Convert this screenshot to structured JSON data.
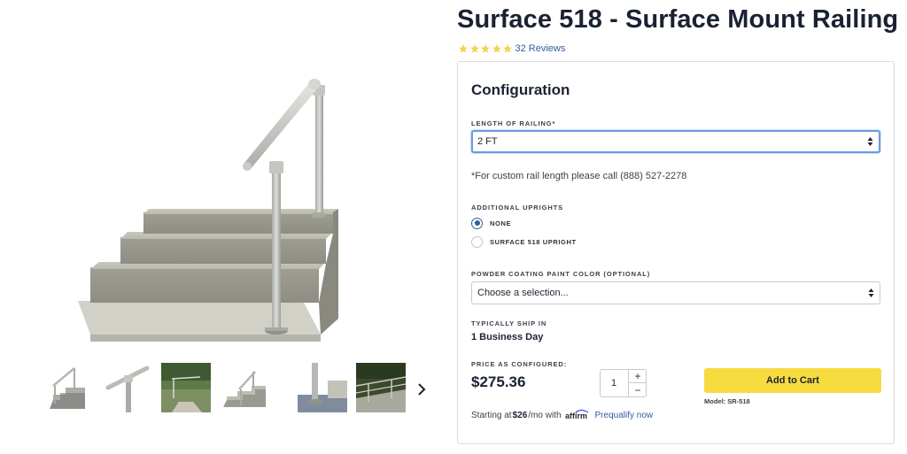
{
  "product": {
    "title": "Surface 518 - Surface Mount Railing",
    "rating": 5,
    "reviews_label": "32 Reviews",
    "star_color": "#f3d34a"
  },
  "configuration": {
    "heading": "Configuration",
    "length": {
      "label": "LENGTH OF RAILING*",
      "selected": "2 FT"
    },
    "custom_note": "*For custom rail length please call (888) 527-2278",
    "uprights": {
      "label": "ADDITIONAL UPRIGHTS",
      "options": [
        {
          "label": "NONE",
          "checked": true
        },
        {
          "label": "SURFACE 518 UPRIGHT",
          "checked": false
        }
      ]
    },
    "paint": {
      "label": "POWDER COATING PAINT COLOR (OPTIONAL)",
      "selected": "Choose a selection..."
    },
    "ship": {
      "label": "TYPICALLY SHIP IN",
      "value": "1 Business Day"
    },
    "price": {
      "label": "PRICE AS CONFIGURED:",
      "value": "$275.36"
    },
    "quantity": {
      "value": "1",
      "plus": "+",
      "minus": "−"
    },
    "add_to_cart": "Add to Cart",
    "model": "Model: SR-518",
    "financing": {
      "prefix": "Starting at",
      "amount": "$26",
      "suffix": "/mo with",
      "provider": "affirm",
      "link": "Prequalify now"
    }
  },
  "gallery": {
    "thumbnails": [
      "stairs-rail-thumb",
      "rail-closeup-thumb",
      "hedge-rail-thumb",
      "rail-stairs-side-thumb",
      "post-base-thumb",
      "outdoor-rail-thumb"
    ],
    "next_icon": "chevron-right-icon"
  },
  "colors": {
    "accent_blue": "#2f5e9e",
    "button_yellow": "#f7dc3f",
    "focus_border": "#6b9be0"
  }
}
